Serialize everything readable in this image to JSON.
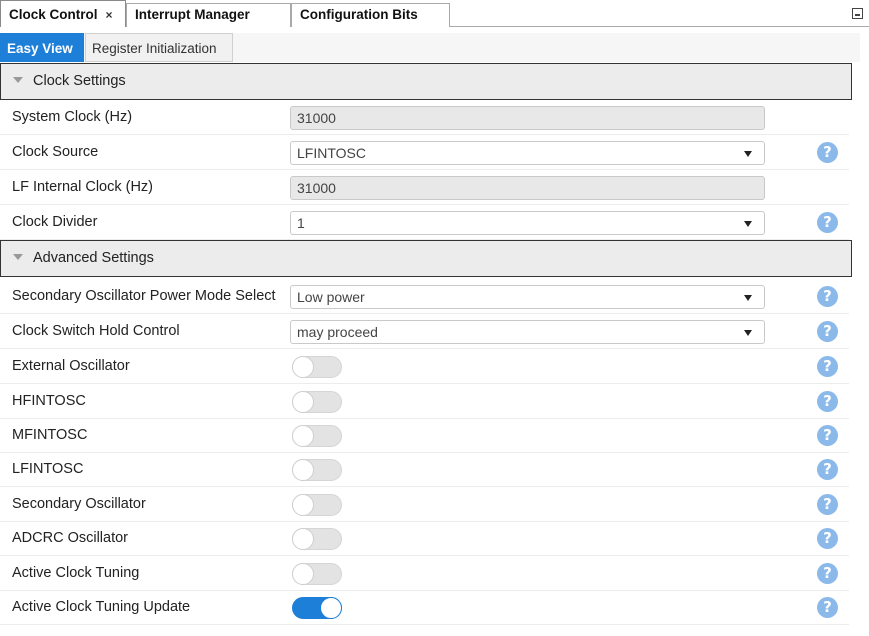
{
  "doc_tabs": [
    {
      "label": "Clock Control",
      "close": "×"
    },
    {
      "label": "Interrupt Manager"
    },
    {
      "label": "Configuration Bits"
    }
  ],
  "sub_tabs": [
    {
      "label": "Easy View"
    },
    {
      "label": "Register Initialization"
    }
  ],
  "clock_settings": {
    "title": "Clock Settings",
    "system_clock": {
      "label": "System Clock (Hz)",
      "value": "31000"
    },
    "clock_source": {
      "label": "Clock Source",
      "value": "LFINTOSC"
    },
    "lf_internal_clock": {
      "label": "LF Internal Clock (Hz)",
      "value": "31000"
    },
    "clock_divider": {
      "label": "Clock Divider",
      "value": "1"
    }
  },
  "advanced_settings": {
    "title": "Advanced Settings",
    "secondary_osc_power_mode": {
      "label": "Secondary Oscillator Power Mode Select",
      "value": "Low power"
    },
    "clock_switch_hold": {
      "label": "Clock Switch Hold Control",
      "value": "may proceed"
    },
    "toggles": [
      {
        "label": "External Oscillator",
        "on": false
      },
      {
        "label": "HFINTOSC",
        "on": false
      },
      {
        "label": "MFINTOSC",
        "on": false
      },
      {
        "label": "LFINTOSC",
        "on": false
      },
      {
        "label": "Secondary Oscillator",
        "on": false
      },
      {
        "label": "ADCRC Oscillator",
        "on": false
      },
      {
        "label": "Active Clock Tuning",
        "on": false
      },
      {
        "label": "Active Clock Tuning Update",
        "on": true
      }
    ]
  },
  "help_glyph": "?",
  "colors": {
    "accent": "#1e7fd8",
    "help": "#8ab9ea"
  }
}
